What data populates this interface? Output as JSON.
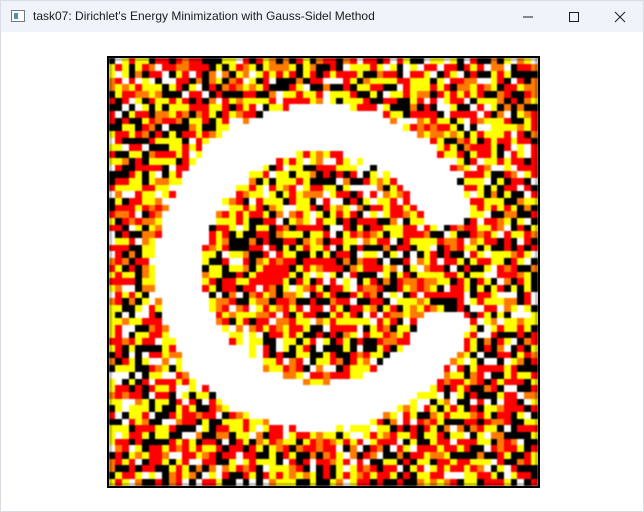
{
  "window": {
    "title": "task07: Dirichlet's Energy Minimization with Gauss-Sidel Method",
    "icon": "app-window-icon",
    "controls": [
      "minimize-icon",
      "maximize-icon",
      "close-icon"
    ]
  },
  "visualization": {
    "kind": "heatmap",
    "colormap": [
      "#000000",
      "#ff0000",
      "#ffff00",
      "#ffffff"
    ],
    "description_shape": "copyright-symbol-like ring",
    "grid_cells": 64
  }
}
